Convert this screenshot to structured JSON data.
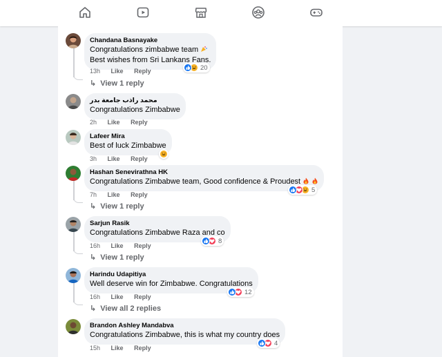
{
  "colors": {
    "like": "#1877f2",
    "haha": "#f7b125",
    "love": "#f33e58",
    "care": "#f7b125"
  },
  "nav": [
    {
      "name": "home-icon"
    },
    {
      "name": "video-icon"
    },
    {
      "name": "marketplace-icon"
    },
    {
      "name": "groups-icon"
    },
    {
      "name": "gaming-icon"
    }
  ],
  "comments": [
    {
      "author": "Chandana Basnayake",
      "lines": [
        "Congratulations zimbabwe team",
        "Best wishes from Sri Lankans Fans."
      ],
      "time": "13h",
      "like": "Like",
      "reply": "Reply",
      "reactions": [
        "like",
        "haha"
      ],
      "count": "20",
      "view_replies": "View 1 reply"
    },
    {
      "author": "محمد راذب جامعة بدر",
      "lines": [
        "Congratulations Zimbabwe"
      ],
      "time": "2h",
      "like": "Like",
      "reply": "Reply"
    },
    {
      "author": "Lafeer Mira",
      "lines": [
        "Best of luck Zimbabwe"
      ],
      "time": "3h",
      "like": "Like",
      "reply": "Reply",
      "reactions": [
        "haha"
      ]
    },
    {
      "author": "Hashan Senevirathna HK",
      "lines": [
        "Congratulations Zimbabwe team, Good confidence & Proudest"
      ],
      "time": "7h",
      "like": "Like",
      "reply": "Reply",
      "reactions": [
        "like",
        "love",
        "haha"
      ],
      "count": "5",
      "view_replies": "View 1 reply"
    },
    {
      "author": "Sarjun Rasik",
      "lines": [
        "Congratulations Zimbabwe Raza and co"
      ],
      "time": "16h",
      "like": "Like",
      "reply": "Reply",
      "reactions": [
        "like",
        "love"
      ],
      "count": "8",
      "view_replies": "View 1 reply"
    },
    {
      "author": "Harindu Udapitiya",
      "lines": [
        "Well deserve win for Zimbabwe. Congratulations"
      ],
      "time": "16h",
      "like": "Like",
      "reply": "Reply",
      "reactions": [
        "like",
        "love"
      ],
      "count": "12",
      "view_replies": "View all 2 replies"
    },
    {
      "author": "Brandon Ashley Mandabva",
      "lines": [
        "Congratulations Zimbabwe, this is what my country does"
      ],
      "time": "15h",
      "like": "Like",
      "reply": "Reply",
      "reactions": [
        "like",
        "love"
      ],
      "count": "4"
    }
  ]
}
